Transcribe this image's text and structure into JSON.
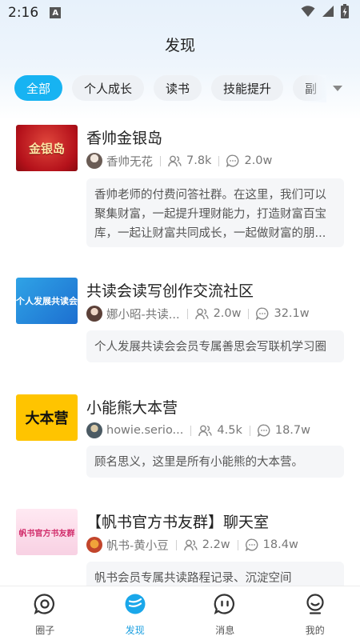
{
  "status": {
    "time": "2:16",
    "indicator": "A"
  },
  "header": {
    "title": "发现"
  },
  "tabs": [
    {
      "label": "全部",
      "active": true
    },
    {
      "label": "个人成长",
      "active": false
    },
    {
      "label": "读书",
      "active": false
    },
    {
      "label": "技能提升",
      "active": false
    },
    {
      "label": "副",
      "active": false
    }
  ],
  "groups": [
    {
      "title": "香帅金银岛",
      "cover_text": "金银岛",
      "owner": "香帅无花",
      "members": "7.8k",
      "posts": "2.0w",
      "description": "香帅老师的付费问答社群。在这里，我们可以聚集财富，一起提升理财能力，打造财富百宝库，一起让财富共同成长，一起做财富的朋..."
    },
    {
      "title": "共读会读写创作交流社区",
      "cover_text": "个人发展共读会",
      "owner": "娜小昭-共读...",
      "members": "2.0w",
      "posts": "32.1w",
      "description": "个人发展共读会会员专属善思会写联机学习圈"
    },
    {
      "title": "小能熊大本营",
      "cover_text": "大本营",
      "owner": "howie.serio...",
      "members": "4.5k",
      "posts": "18.7w",
      "description": "顾名思义，这里是所有小能熊的大本营。"
    },
    {
      "title": "【帆书官方书友群】聊天室",
      "cover_text": "帆书官方书友群",
      "owner": "帆书-黄小豆",
      "members": "2.2w",
      "posts": "18.4w",
      "description": "帆书会员专属共读路程记录、沉淀空间"
    }
  ],
  "bottom_nav": [
    {
      "label": "圈子",
      "icon": "circle-chat-icon",
      "active": false
    },
    {
      "label": "发现",
      "icon": "discover-icon",
      "active": true
    },
    {
      "label": "消息",
      "icon": "message-icon",
      "active": false
    },
    {
      "label": "我的",
      "icon": "profile-icon",
      "active": false
    }
  ],
  "colors": {
    "accent": "#17b3f2",
    "nav_active": "#1a9fe0"
  }
}
